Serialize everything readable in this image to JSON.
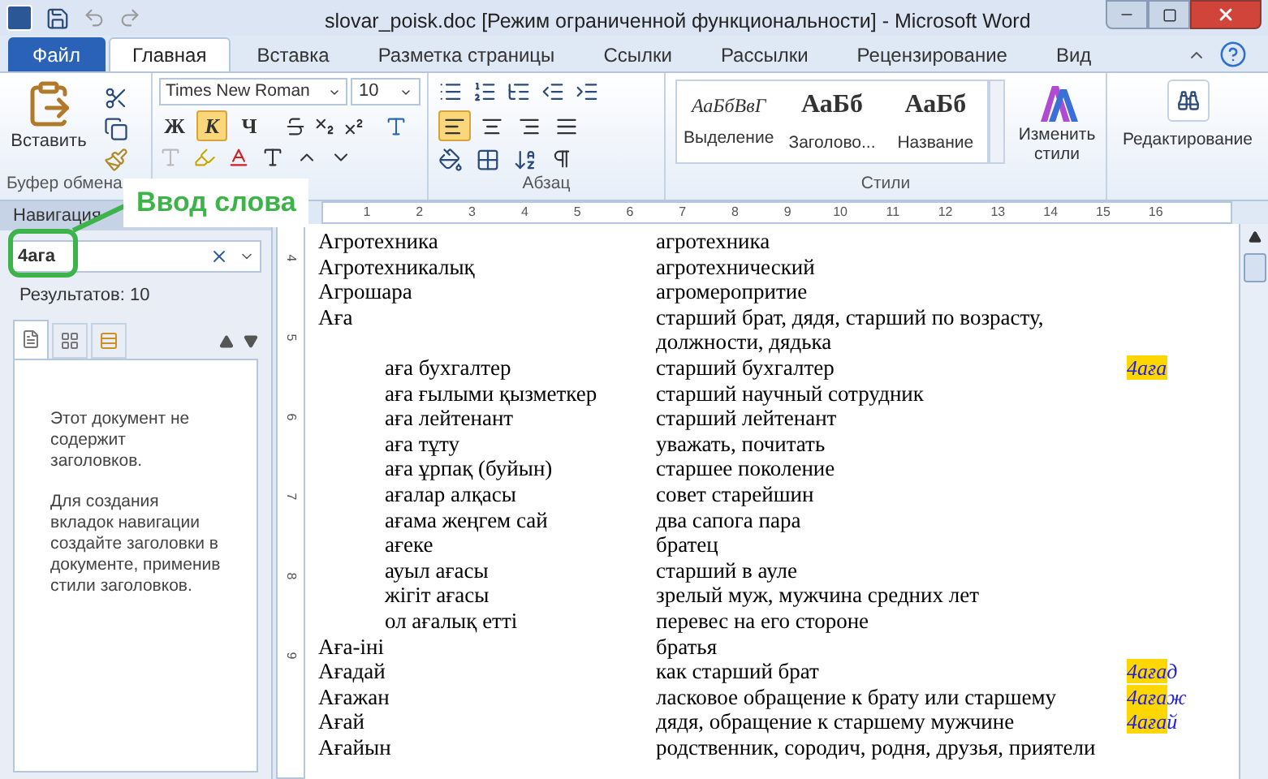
{
  "window": {
    "title": "slovar_poisk.doc [Режим ограниченной функциональности]  -  Microsoft Word"
  },
  "tabs": [
    {
      "label": "Файл",
      "kind": "file",
      "selected": false
    },
    {
      "label": "Главная",
      "kind": "tab",
      "selected": true
    },
    {
      "label": "Вставка",
      "kind": "tab",
      "selected": false
    },
    {
      "label": "Разметка страницы",
      "kind": "tab",
      "selected": false
    },
    {
      "label": "Ссылки",
      "kind": "tab",
      "selected": false
    },
    {
      "label": "Рассылки",
      "kind": "tab",
      "selected": false
    },
    {
      "label": "Рецензирование",
      "kind": "tab",
      "selected": false
    },
    {
      "label": "Вид",
      "kind": "tab",
      "selected": false
    }
  ],
  "ribbon": {
    "paste": "Вставить",
    "clipboard_group": "Буфер обмена",
    "font_name": "Times New Roman",
    "font_size": "10",
    "format_buttons": [
      {
        "label": "Ж",
        "selected": false
      },
      {
        "label": "К",
        "selected": true
      },
      {
        "label": "Ч",
        "selected": false
      }
    ],
    "align_buttons": [
      {
        "selected": true
      },
      {
        "selected": false
      },
      {
        "selected": false
      },
      {
        "selected": false
      }
    ],
    "paragraph_group": "Абзац",
    "styles": [
      {
        "sample": "АаБбВвГ",
        "label": "Выделение",
        "kind": "italic"
      },
      {
        "sample": "АаБб",
        "label": "Заголово...",
        "kind": "heading"
      },
      {
        "sample": "АаБб",
        "label": "Название",
        "kind": "title"
      }
    ],
    "styles_group": "Стили",
    "change_styles": "Изменить стили",
    "editing": "Редактирование"
  },
  "navigation": {
    "title": "Навигация",
    "search": {
      "value": "4ага"
    },
    "results": "Результатов: 10",
    "message": [
      "Этот документ не содержит заголовков.",
      "Для создания вкладок навигации создайте заголовки в документе, применив стили заголовков."
    ],
    "callout": "Ввод слова"
  },
  "rulers": {
    "horizontal": [
      "1",
      "2",
      "3",
      "4",
      "5",
      "6",
      "7",
      "8",
      "9",
      "10",
      "11",
      "12",
      "13",
      "14",
      "15",
      "16"
    ],
    "vertical": [
      "4",
      "5",
      "6",
      "7",
      "8",
      "9"
    ]
  },
  "document": {
    "entries": [
      {
        "term": "Агротехника",
        "translation": "агротехника"
      },
      {
        "term": "Агротехникалық",
        "translation": "агротехнический"
      },
      {
        "term": "Агрошара",
        "translation": "агромеропритие"
      },
      {
        "term": "Аға",
        "translation": "старший брат, дядя, старший по возрасту, должности, дядька",
        "children": [
          {
            "term": "аға бухгалтер",
            "translation": "старший бухгалтер",
            "tag": {
              "match": "4аға"
            }
          },
          {
            "term": "аға ғылыми қызметкер",
            "translation": "старший научный сотрудник"
          },
          {
            "term": "аға лейтенант",
            "translation": "старший лейтенант"
          },
          {
            "term": "аға тұту",
            "translation": "уважать, почитать"
          },
          {
            "term": "аға ұрпақ (буйын)",
            "translation": "старшее поколение"
          },
          {
            "term": "ағалар алқасы",
            "translation": "совет старейшин"
          },
          {
            "term": "ағама жеңгем сай",
            "translation": "два сапога пара"
          },
          {
            "term": "ағеке",
            "translation": "братец"
          },
          {
            "term": "ауыл ағасы",
            "translation": "старший в ауле"
          },
          {
            "term": "жігіт ағасы",
            "translation": "зрелый муж, мужчина средних лет"
          },
          {
            "term": "ол ағалық етті",
            "translation": "перевес на его стороне"
          }
        ]
      },
      {
        "term": "Аға-іні",
        "translation": "братья"
      },
      {
        "term": "Ағадай",
        "translation": "как старший брат",
        "tag": {
          "match": "4аға",
          "rest": "д"
        }
      },
      {
        "term": "Ағажан",
        "translation": "ласковое обращение к брату или старшему",
        "tag": {
          "match": "4аға",
          "rest": "ж"
        }
      },
      {
        "term": "Ағай",
        "translation": "дядя, обращение к старшему мужчине",
        "tag": {
          "match": "4аға",
          "rest": "й"
        }
      },
      {
        "term": "Ағайын",
        "translation": "родственник, сородич, родня, друзья,  приятели"
      }
    ]
  }
}
